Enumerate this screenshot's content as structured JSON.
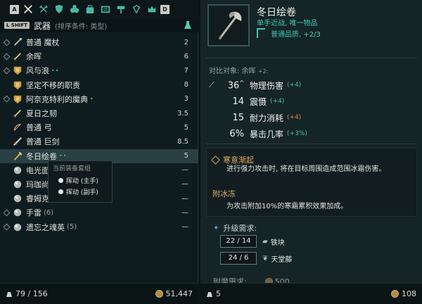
{
  "category_bar": {
    "left_key": "A",
    "right_key": "D",
    "icons": [
      "crossed-swords-icon",
      "crossed-axes-icon",
      "shield-icon",
      "potion-icon",
      "bag-icon",
      "scroll-icon",
      "hammer-icon",
      "gem-icon",
      "crown-icon"
    ]
  },
  "weapon_header": {
    "shift_key": "L SHIFT",
    "title": "武器",
    "sort_hint": "(排序条件: 类型)"
  },
  "weapons": [
    {
      "name": "普通 魔杖",
      "marks": "",
      "value": "2",
      "icon": "wand-icon",
      "slot": "diamond"
    },
    {
      "name": "余晖",
      "marks": "",
      "value": "6",
      "icon": "sword-icon",
      "slot": "diamond"
    },
    {
      "name": "风与浪",
      "marks": "••",
      "value": "7",
      "icon": "unique-badge-icon",
      "slot": "diamond"
    },
    {
      "name": "坚定不移的职责",
      "marks": "",
      "value": "8",
      "icon": "unique-badge-icon",
      "slot": "none"
    },
    {
      "name": "阿奈克特利的魔典",
      "marks": "•",
      "value": "3",
      "icon": "unique-badge-icon",
      "slot": "diamond"
    },
    {
      "name": "夏日之韧",
      "marks": "",
      "value": "3.5",
      "icon": "sword-icon",
      "slot": "none"
    },
    {
      "name": "普通 弓",
      "marks": "",
      "value": "5",
      "icon": "bow-icon",
      "slot": "none"
    },
    {
      "name": "普通 巨剑",
      "marks": "",
      "value": "8.5",
      "icon": "greatsword-icon",
      "slot": "none"
    },
    {
      "name": "冬日绘卷",
      "marks": "••",
      "value": "5",
      "icon": "axe-icon",
      "slot": "none"
    },
    {
      "name": "电光面",
      "marks": "",
      "value": "—",
      "icon": "orb-icon",
      "slot": "none"
    },
    {
      "name": "玛珈尚",
      "marks": "",
      "value": "—",
      "icon": "orb-icon",
      "slot": "none"
    },
    {
      "name": "睿姆克之眼",
      "marks": "",
      "count": "(4)",
      "value": "—",
      "icon": "orb-icon",
      "slot": "none"
    },
    {
      "name": "手雷",
      "marks": "",
      "count": "(6)",
      "value": "—",
      "icon": "orb-icon",
      "slot": "diamond"
    },
    {
      "name": "遗忘之魂英",
      "marks": "",
      "count": "(5)",
      "value": "—",
      "icon": "orb-icon",
      "slot": "diamond"
    }
  ],
  "selected_index": 8,
  "tooltip": {
    "title": "当前装备套组",
    "items": [
      "挥动 (主手)",
      "挥动 (副手)"
    ]
  },
  "footer_left": {
    "weight": "79 / 156",
    "gold": "51,447"
  },
  "item": {
    "name": "冬日绘卷",
    "subtitle": "单手近战, 唯一物品",
    "quality_label": "普通品质,",
    "quality_value": "+2/3",
    "compare_label": "对比对象: 余晖",
    "compare_suffix": "+2:",
    "stats": [
      {
        "value": "36",
        "sup": "^",
        "label": "物理伤害",
        "delta": "(+4)",
        "tone": "green",
        "has_icon": true
      },
      {
        "value": "14",
        "sup": "",
        "label": "震慑",
        "delta": "(+4)",
        "tone": "green",
        "has_icon": false
      },
      {
        "value": "15",
        "sup": "",
        "label": "耐力消耗",
        "delta": "(+4)",
        "tone": "orange",
        "has_icon": false
      },
      {
        "value": "6%",
        "sup": "",
        "label": "暴击几率",
        "delta": "(+3%)",
        "tone": "green",
        "has_icon": false
      }
    ],
    "perk_title": "寒意渐起",
    "perk_desc": "进行强力攻击时, 将在目标周围造成范围冰霜伤害。",
    "enchant_title": "附冰冻",
    "enchant_desc": "为攻击附加10%的寒霜累积效果加成。",
    "upgrade_title": "升级需求:",
    "requirements": [
      {
        "amount": "22 / 14",
        "name": "铁块"
      },
      {
        "amount": "24 / 6",
        "name": "天堂藤"
      }
    ],
    "enchant_req_label": "附魔需求:",
    "enchant_req_value": "500"
  },
  "footer_right": {
    "weight": "5",
    "gold": "108"
  },
  "colors": {
    "teal_accent": "#3fc7b5",
    "gold_text": "#e0ac63",
    "positive": "#3fc7a0",
    "negative": "#e0894a"
  }
}
